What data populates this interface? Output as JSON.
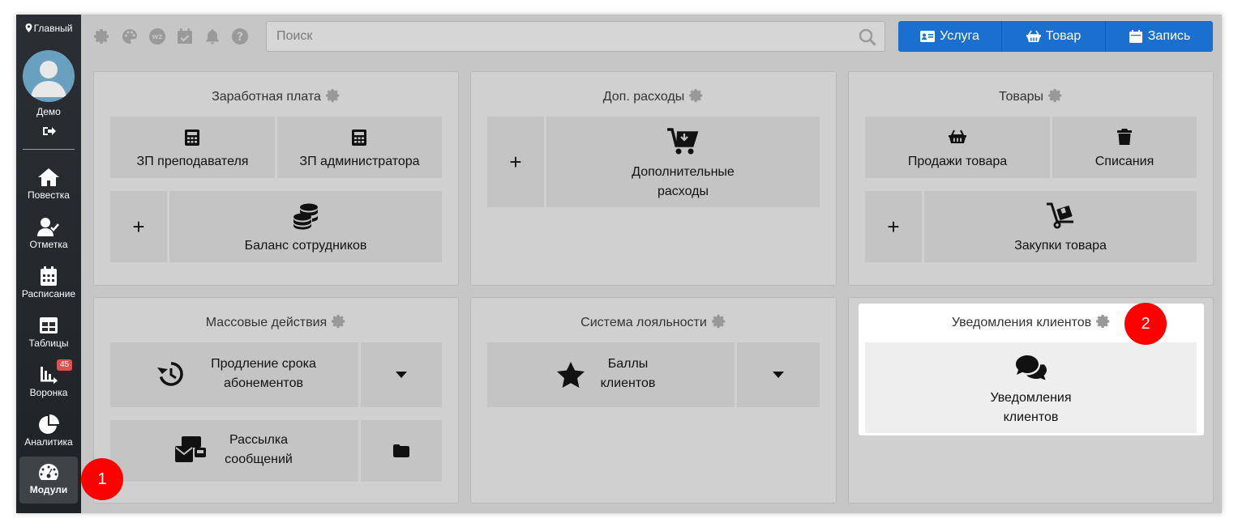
{
  "sidebar": {
    "location": "Главный",
    "user_name": "Демо",
    "items": [
      {
        "label": "Повестка",
        "icon": "home-icon"
      },
      {
        "label": "Отметка",
        "icon": "user-check-icon"
      },
      {
        "label": "Расписание",
        "icon": "calendar-icon"
      },
      {
        "label": "Таблицы",
        "icon": "table-icon"
      },
      {
        "label": "Воронка",
        "icon": "funnel-icon",
        "badge": "45"
      },
      {
        "label": "Аналитика",
        "icon": "pie-chart-icon"
      },
      {
        "label": "Модули",
        "icon": "gauge-icon",
        "active": true
      }
    ]
  },
  "topbar": {
    "icons": [
      "gear-icon",
      "palette-icon",
      "wz-icon",
      "calendar-check-icon",
      "bell-icon",
      "question-icon"
    ],
    "search_placeholder": "Поиск",
    "buttons": [
      {
        "label": "Услуга",
        "icon": "id-card-icon"
      },
      {
        "label": "Товар",
        "icon": "basket-icon"
      },
      {
        "label": "Запись",
        "icon": "calendar-icon"
      }
    ]
  },
  "cards": {
    "salary": {
      "title": "Заработная плата",
      "tile1": "ЗП преподавателя",
      "tile2": "ЗП администратора",
      "plus": "+",
      "tile3": "Баланс сотрудников"
    },
    "expenses": {
      "title": "Доп. расходы",
      "plus": "+",
      "tile1_line1": "Дополнительные",
      "tile1_line2": "расходы"
    },
    "goods": {
      "title": "Товары",
      "tile1": "Продажи товара",
      "tile2": "Списания",
      "plus": "+",
      "tile3": "Закупки товара"
    },
    "mass": {
      "title": "Массовые действия",
      "tile1_line1": "Продление срока",
      "tile1_line2": "абонементов",
      "tile2_line1": "Рассылка",
      "tile2_line2": "сообщений"
    },
    "loyalty": {
      "title": "Система лояльности",
      "tile1_line1": "Баллы",
      "tile1_line2": "клиентов"
    },
    "notify": {
      "title": "Уведомления клиентов",
      "tile1_line1": "Уведомления",
      "tile1_line2": "клиентов"
    }
  },
  "markers": {
    "m1": "1",
    "m2": "2"
  },
  "colors": {
    "accent": "#1a6fcf",
    "marker": "#ff0000",
    "badge": "#d9534f"
  }
}
